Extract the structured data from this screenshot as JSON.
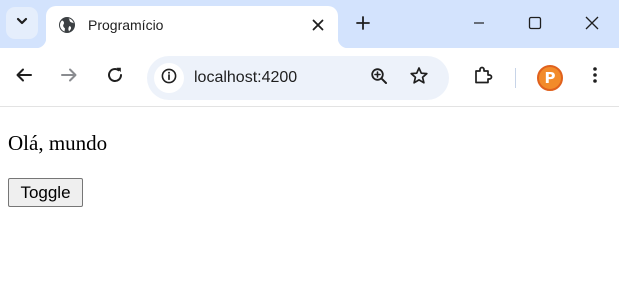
{
  "browser": {
    "tab": {
      "title": "Programício"
    },
    "address_bar": {
      "url": "localhost:4200"
    },
    "profile": {
      "initial": "P",
      "color": "#f28b2a"
    },
    "icons": [
      "tab-search-chevron-icon",
      "globe-icon",
      "close-icon",
      "plus-icon",
      "minimize-icon",
      "maximize-icon",
      "window-close-icon",
      "back-arrow-icon",
      "forward-arrow-icon",
      "reload-icon",
      "info-icon",
      "zoom-icon",
      "star-icon",
      "extensions-icon",
      "more-vert-icon"
    ],
    "colors": {
      "tabstrip": "#d3e3fd",
      "omnibox": "#edf2fa"
    }
  },
  "page": {
    "greeting": "Olá, mundo",
    "toggle_button_label": "Toggle"
  }
}
